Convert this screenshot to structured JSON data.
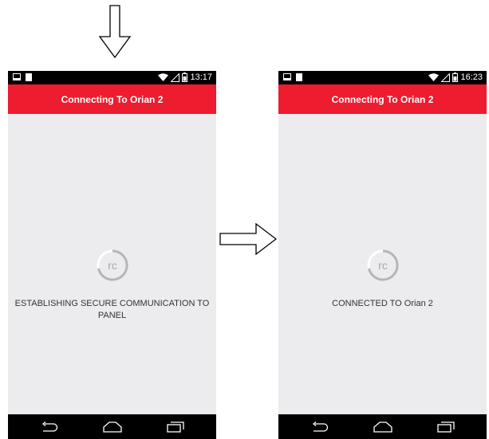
{
  "screens": [
    {
      "status_time": "13:17",
      "app_bar_title": "Connecting To Orian 2",
      "logo_text": "rc",
      "message_line1": "ESTABLISHING SECURE COMMUNICATION TO",
      "message_line2": "PANEL"
    },
    {
      "status_time": "16:23",
      "app_bar_title": "Connecting To Orian 2",
      "logo_text": "rc",
      "message_line1": "CONNECTED TO Orian 2",
      "message_line2": ""
    }
  ],
  "icons": {
    "status": [
      "notification-icon",
      "storage-icon",
      "wifi-icon",
      "signal-icon",
      "battery-icon"
    ],
    "nav": [
      "back-icon",
      "home-icon",
      "recent-apps-icon"
    ],
    "flow_arrows": [
      "arrow-down-icon",
      "arrow-right-icon"
    ]
  },
  "colors": {
    "app_bar": "#ed1c2e",
    "screen_background": "#ececee",
    "system_bars": "#000000"
  }
}
